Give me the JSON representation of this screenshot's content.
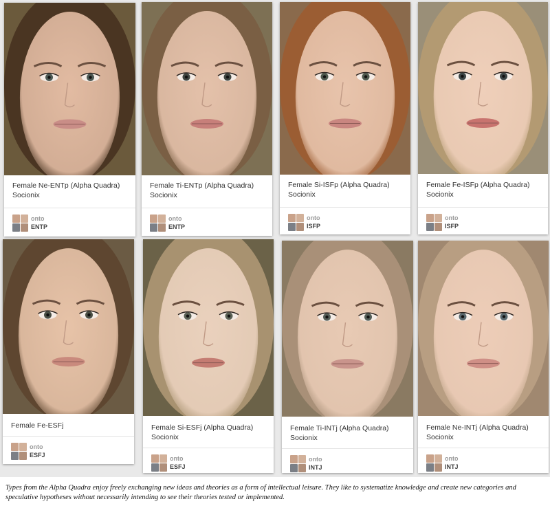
{
  "pins": [
    {
      "title": "Female Ne-ENTp (Alpha Quadra) Socionix",
      "user": "onto",
      "board": "ENTP",
      "colors": {
        "bg": "#6b5a3c",
        "hair": "#4a3522",
        "skin": "#e2bba2",
        "lips": "#c98d87",
        "eye": "#4d5a55"
      }
    },
    {
      "title": "Female Ti-ENTp (Alpha Quadra) Socionix",
      "user": "onto",
      "board": "ENTP",
      "colors": {
        "bg": "#7d7054",
        "hair": "#7a5f44",
        "skin": "#e4c1aa",
        "lips": "#c77f7a",
        "eye": "#3f4540"
      }
    },
    {
      "title": "Female Si-ISFp (Alpha Quadra) Socionix",
      "user": "onto",
      "board": "ISFP",
      "colors": {
        "bg": "#8a6a4c",
        "hair": "#9b5d33",
        "skin": "#e8c4ac",
        "lips": "#c98680",
        "eye": "#4f5a4e"
      }
    },
    {
      "title": "Female Fe-ISFp (Alpha Quadra) Socionix",
      "user": "onto",
      "board": "ISFP",
      "colors": {
        "bg": "#9a8f78",
        "hair": "#b39a72",
        "skin": "#efcfba",
        "lips": "#c8736e",
        "eye": "#3c4546"
      }
    },
    {
      "title": "Female Fe-ESFj",
      "user": "onto",
      "board": "ESFJ",
      "colors": {
        "bg": "#6b5b44",
        "hair": "#5e4630",
        "skin": "#e7c3a8",
        "lips": "#c98a7d",
        "eye": "#4a4f45"
      }
    },
    {
      "title": "Female Si-ESFj (Alpha Quadra) Socionix",
      "user": "onto",
      "board": "ESFJ",
      "colors": {
        "bg": "#6b6248",
        "hair": "#a89270",
        "skin": "#ead1bd",
        "lips": "#c47c72",
        "eye": "#5a6156"
      }
    },
    {
      "title": "Female Ti-INTj (Alpha Quadra) Socionix",
      "user": "onto",
      "board": "INTJ",
      "colors": {
        "bg": "#8a7a62",
        "hair": "#a99078",
        "skin": "#e8cab4",
        "lips": "#c9948c",
        "eye": "#535d57"
      }
    },
    {
      "title": "Female Ne-INTj (Alpha Quadra) Socionix",
      "user": "onto",
      "board": "INTJ",
      "colors": {
        "bg": "#a08870",
        "hair": "#b89e82",
        "skin": "#edcdb8",
        "lips": "#cf8f86",
        "eye": "#5a6a70"
      }
    }
  ],
  "caption": "Types from the Alpha Quadra enjoy freely exchanging new ideas and theories as a form of intellectual leisure. They like to systematize knowledge and create new categories and speculative hypotheses without necessarily intending to see their theories tested or implemented."
}
